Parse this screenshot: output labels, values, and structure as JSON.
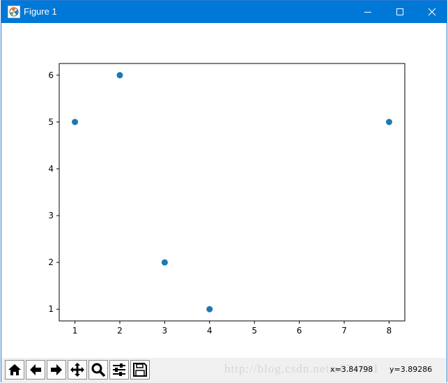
{
  "window": {
    "title": "Figure 1",
    "minimize_icon": "minimize-icon",
    "maximize_icon": "maximize-icon",
    "close_icon": "close-icon"
  },
  "colors": {
    "titlebar": "#0078d7",
    "marker": "#1f77b4",
    "toolbar_bg": "#f0f0f0"
  },
  "toolbar": {
    "buttons": [
      {
        "name": "home",
        "icon": "home-icon"
      },
      {
        "name": "back",
        "icon": "arrow-left-icon"
      },
      {
        "name": "forward",
        "icon": "arrow-right-icon"
      },
      {
        "name": "pan",
        "icon": "move-icon"
      },
      {
        "name": "zoom",
        "icon": "magnifier-icon"
      },
      {
        "name": "subplots",
        "icon": "sliders-icon"
      },
      {
        "name": "save",
        "icon": "floppy-disk-icon"
      }
    ],
    "x_readout": "x=3.84798",
    "y_readout": "y=3.89286",
    "watermark": "http://blog.csdn.net/a871961"
  },
  "chart_data": {
    "type": "scatter",
    "x": [
      1,
      2,
      3,
      4,
      8
    ],
    "y": [
      5,
      6,
      2,
      1,
      5
    ],
    "xticks": [
      "1",
      "2",
      "3",
      "4",
      "5",
      "6",
      "7",
      "8"
    ],
    "yticks": [
      "1",
      "2",
      "3",
      "4",
      "5",
      "6"
    ],
    "xlim": [
      0.65,
      8.35
    ],
    "ylim": [
      0.75,
      6.25
    ],
    "grid": false,
    "title": "",
    "xlabel": "",
    "ylabel": ""
  }
}
